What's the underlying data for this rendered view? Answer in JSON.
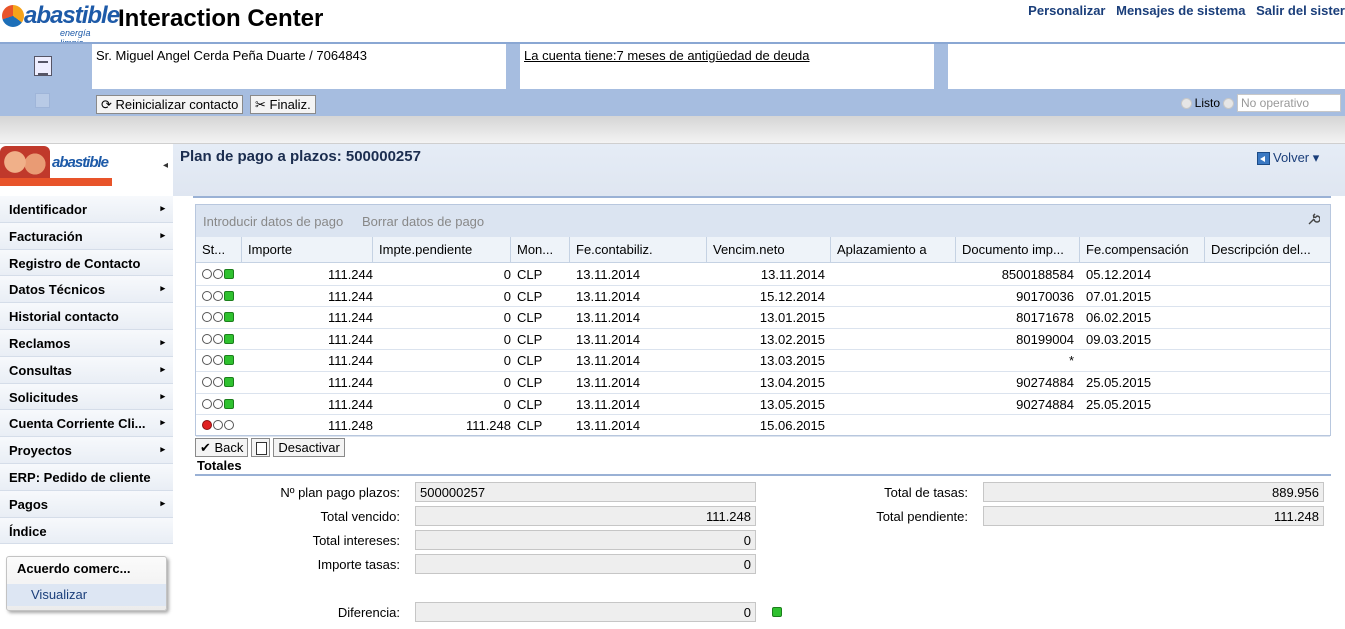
{
  "header": {
    "brand": "abastible",
    "brand_tagline": "energía limpia",
    "app_title": "Interaction Center",
    "links": [
      "Personalizar",
      "Mensajes de sistema",
      "Salir del sister"
    ]
  },
  "context": {
    "customer": "Sr. Miguel Angel Cerda Peña Duarte / 7064843",
    "alert": "La cuenta tiene:7 meses de antigüedad de deuda",
    "btn_reset": "⟳ Reinicializar contacto",
    "btn_finalize": "✂ Finaliz.",
    "status_listo": "Listo",
    "status_noop": "No operativo"
  },
  "nav": {
    "logo_text": "abastible",
    "collapse": "◂",
    "items": [
      {
        "label": "Identificador",
        "arrow": "▸"
      },
      {
        "label": "Facturación",
        "arrow": "▸"
      },
      {
        "label": "Registro de Contacto",
        "arrow": ""
      },
      {
        "label": "Datos Técnicos",
        "arrow": "▸"
      },
      {
        "label": "Historial contacto",
        "arrow": ""
      },
      {
        "label": "Reclamos",
        "arrow": "▸"
      },
      {
        "label": "Consultas",
        "arrow": "▸"
      },
      {
        "label": "Solicitudes",
        "arrow": "▸"
      },
      {
        "label": "Cuenta Corriente Cli...",
        "arrow": "▸"
      },
      {
        "label": "Proyectos",
        "arrow": "▸"
      },
      {
        "label": "ERP: Pedido de cliente",
        "arrow": ""
      },
      {
        "label": "Pagos",
        "arrow": "▸"
      },
      {
        "label": "Índice",
        "arrow": ""
      }
    ],
    "panel_title": "Acuerdo comerc...",
    "panel_link": "Visualizar"
  },
  "page": {
    "title": "Plan de pago a plazos: 500000257",
    "volver": "Volver ▾"
  },
  "table": {
    "toolbar": {
      "intro": "Introducir datos de pago",
      "borrar": "Borrar datos de pago"
    },
    "columns": [
      "St...",
      "Importe",
      "Impte.pendiente",
      "Mon...",
      "Fe.contabiliz.",
      "Vencim.neto",
      "Aplazamiento a",
      "Documento imp...",
      "Fe.compensación",
      "Descripción del..."
    ],
    "rows": [
      {
        "status": "green",
        "importe": "111.244",
        "pendiente": "0",
        "moneda": "CLP",
        "contab": "13.11.2014",
        "venc": "13.11.2014",
        "aplaz": "",
        "doc": "8500188584",
        "comp": "05.12.2014",
        "desc": ""
      },
      {
        "status": "green",
        "importe": "111.244",
        "pendiente": "0",
        "moneda": "CLP",
        "contab": "13.11.2014",
        "venc": "15.12.2014",
        "aplaz": "",
        "doc": "90170036",
        "comp": "07.01.2015",
        "desc": ""
      },
      {
        "status": "green",
        "importe": "111.244",
        "pendiente": "0",
        "moneda": "CLP",
        "contab": "13.11.2014",
        "venc": "13.01.2015",
        "aplaz": "",
        "doc": "80171678",
        "comp": "06.02.2015",
        "desc": ""
      },
      {
        "status": "green",
        "importe": "111.244",
        "pendiente": "0",
        "moneda": "CLP",
        "contab": "13.11.2014",
        "venc": "13.02.2015",
        "aplaz": "",
        "doc": "80199004",
        "comp": "09.03.2015",
        "desc": ""
      },
      {
        "status": "green",
        "importe": "111.244",
        "pendiente": "0",
        "moneda": "CLP",
        "contab": "13.11.2014",
        "venc": "13.03.2015",
        "aplaz": "",
        "doc": "*",
        "comp": "",
        "desc": ""
      },
      {
        "status": "green",
        "importe": "111.244",
        "pendiente": "0",
        "moneda": "CLP",
        "contab": "13.11.2014",
        "venc": "13.04.2015",
        "aplaz": "",
        "doc": "90274884",
        "comp": "25.05.2015",
        "desc": ""
      },
      {
        "status": "green",
        "importe": "111.244",
        "pendiente": "0",
        "moneda": "CLP",
        "contab": "13.11.2014",
        "venc": "13.05.2015",
        "aplaz": "",
        "doc": "90274884",
        "comp": "25.05.2015",
        "desc": ""
      },
      {
        "status": "red",
        "importe": "111.248",
        "pendiente": "111.248",
        "moneda": "CLP",
        "contab": "13.11.2014",
        "venc": "15.06.2015",
        "aplaz": "",
        "doc": "",
        "comp": "",
        "desc": ""
      }
    ]
  },
  "actions": {
    "back": "✔ Back",
    "desactivar": "Desactivar"
  },
  "totales": {
    "title": "Totales",
    "nro_plan_label": "Nº plan pago plazos:",
    "nro_plan": "500000257",
    "vencido_label": "Total vencido:",
    "vencido": "111.248",
    "intereses_label": "Total intereses:",
    "intereses": "0",
    "tasas_imp_label": "Importe tasas:",
    "tasas_imp": "0",
    "diferencia_label": "Diferencia:",
    "diferencia": "0",
    "total_tasas_label": "Total de tasas:",
    "total_tasas": "889.956",
    "pendiente_label": "Total pendiente:",
    "pendiente": "111.248"
  },
  "colors": {
    "accent": "#a6bde0",
    "status_green": "#2fc12f",
    "status_red": "#e02020"
  }
}
